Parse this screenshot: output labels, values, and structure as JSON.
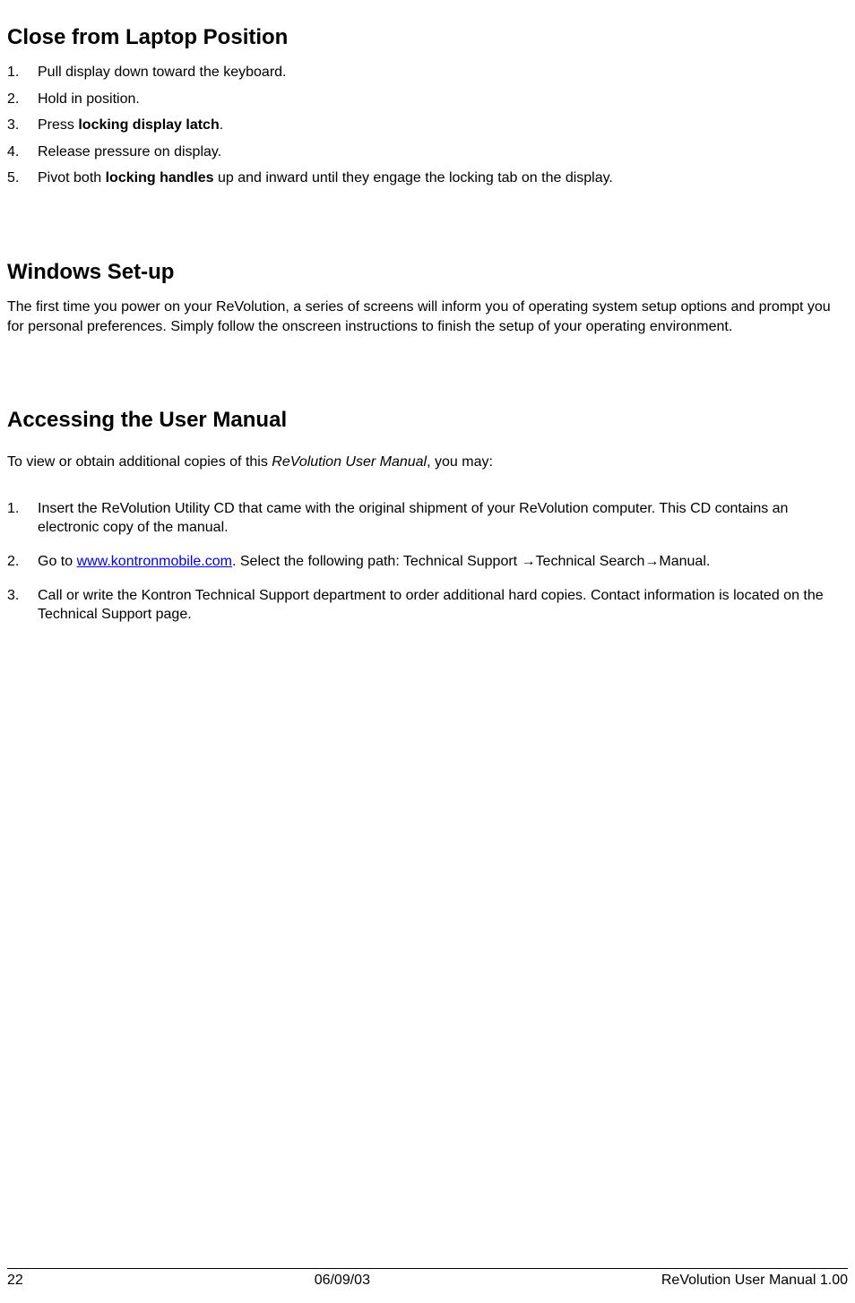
{
  "section1": {
    "heading": "Close from Laptop Position",
    "steps": {
      "s1": "Pull display down toward the keyboard.",
      "s2": "Hold in position.",
      "s3_pre": "Press ",
      "s3_bold": "locking display latch",
      "s3_post": ".",
      "s4": "Release pressure on display.",
      "s5_pre": "Pivot both ",
      "s5_bold": "locking handles",
      "s5_post": " up and inward until they engage the locking tab on the display."
    }
  },
  "section2": {
    "heading": "Windows Set-up",
    "body": "The first time you power on your ReVolution, a series of screens will inform you of operating system setup options and prompt you for personal preferences. Simply follow the onscreen instructions to finish the setup of your operating environment."
  },
  "section3": {
    "heading": "Accessing the User Manual",
    "intro_pre": "To view or obtain additional copies of this ",
    "intro_italic": "ReVolution User Manual",
    "intro_post": ", you may:",
    "steps": {
      "s1": "Insert the ReVolution Utility CD that came with the original shipment of your ReVolution computer. This CD contains an electronic copy of the manual.",
      "s2_pre": "Go to ",
      "s2_link": "www.kontronmobile.com",
      "s2_post": ". Select the following path: Technical Support →Technical Search→Manual.",
      "s3": "Call or write the Kontron Technical Support department to order additional hard copies. Contact information is located on the Technical Support page."
    }
  },
  "footer": {
    "page": "22",
    "date": "06/09/03",
    "title": "ReVolution User Manual 1.00"
  }
}
